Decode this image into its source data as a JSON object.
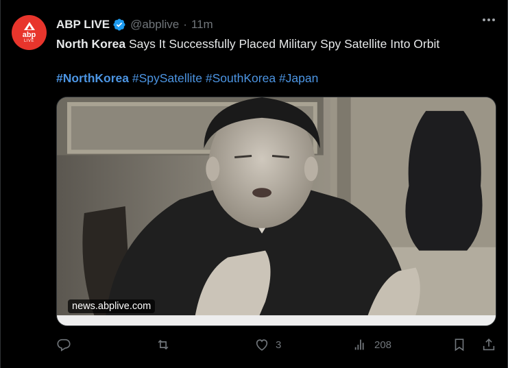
{
  "account": {
    "name": "ABP LIVE",
    "handle": "@abplive",
    "separator": "·",
    "time": "11m",
    "avatar_text": "abp",
    "avatar_sub": "LIVE"
  },
  "post": {
    "lead_bold": "North Korea",
    "headline": " Says It Successfully Placed Military Spy Satellite Into Orbit",
    "hashtags": [
      "#NorthKorea",
      "#SpySatellite",
      "#SouthKorea",
      "#Japan"
    ]
  },
  "media": {
    "caption": "news.abplive.com"
  },
  "actions": {
    "reply_count": "",
    "repost_count": "",
    "like_count": "3",
    "views_count": "208"
  },
  "colors": {
    "background": "#000000",
    "link": "#4c95e3",
    "muted": "#71767b",
    "verified": "#1d9bf0",
    "avatar": "#e8352c"
  },
  "icons": [
    "verified-badge-icon",
    "more-options-icon",
    "reply-icon",
    "repost-icon",
    "like-icon",
    "views-icon",
    "bookmark-icon",
    "share-icon"
  ]
}
